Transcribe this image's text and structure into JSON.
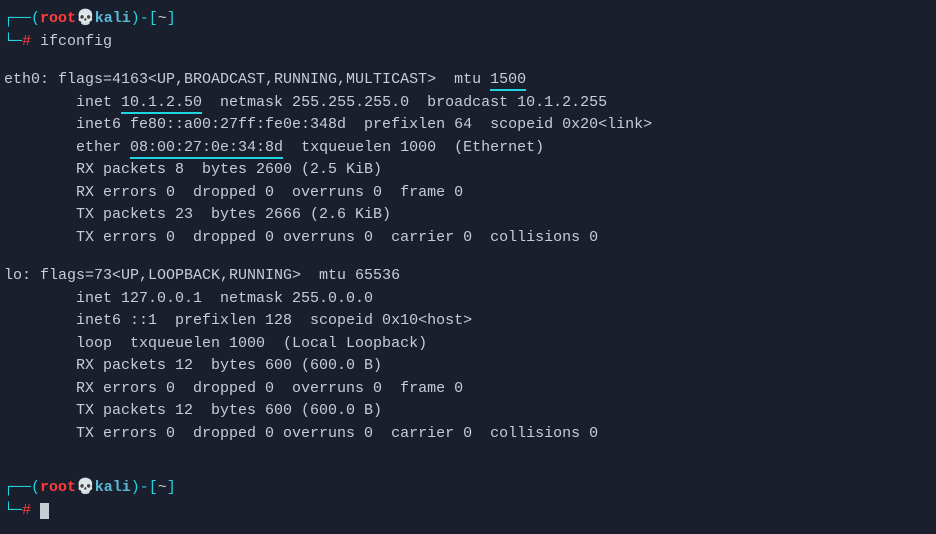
{
  "prompt": {
    "open_top": "┌──(",
    "user": "root",
    "skull": "💀",
    "host": "kali",
    "close_paren": ")",
    "dash": "-",
    "bracket_open": "[",
    "path": "~",
    "bracket_close": "]",
    "open_bottom": "└─",
    "hash": "#"
  },
  "command": "ifconfig",
  "eth0": {
    "header": "eth0: flags=4163<UP,BROADCAST,RUNNING,MULTICAST>  mtu ",
    "mtu": "1500",
    "inet_prefix": "        inet ",
    "inet_ip": "10.1.2.50",
    "inet_rest": "  netmask 255.255.255.0  broadcast 10.1.2.255",
    "inet6": "        inet6 fe80::a00:27ff:fe0e:348d  prefixlen 64  scopeid 0x20<link>",
    "ether_prefix": "        ether ",
    "ether_mac": "08:00:27:0e:34:8d",
    "ether_rest": "  txqueuelen 1000  (Ethernet)",
    "rx_packets": "        RX packets 8  bytes 2600 (2.5 KiB)",
    "rx_errors": "        RX errors 0  dropped 0  overruns 0  frame 0",
    "tx_packets": "        TX packets 23  bytes 2666 (2.6 KiB)",
    "tx_errors": "        TX errors 0  dropped 0 overruns 0  carrier 0  collisions 0"
  },
  "lo": {
    "header": "lo: flags=73<UP,LOOPBACK,RUNNING>  mtu 65536",
    "inet": "        inet 127.0.0.1  netmask 255.0.0.0",
    "inet6": "        inet6 ::1  prefixlen 128  scopeid 0x10<host>",
    "loop": "        loop  txqueuelen 1000  (Local Loopback)",
    "rx_packets": "        RX packets 12  bytes 600 (600.0 B)",
    "rx_errors": "        RX errors 0  dropped 0  overruns 0  frame 0",
    "tx_packets": "        TX packets 12  bytes 600 (600.0 B)",
    "tx_errors": "        TX errors 0  dropped 0 overruns 0  carrier 0  collisions 0"
  }
}
